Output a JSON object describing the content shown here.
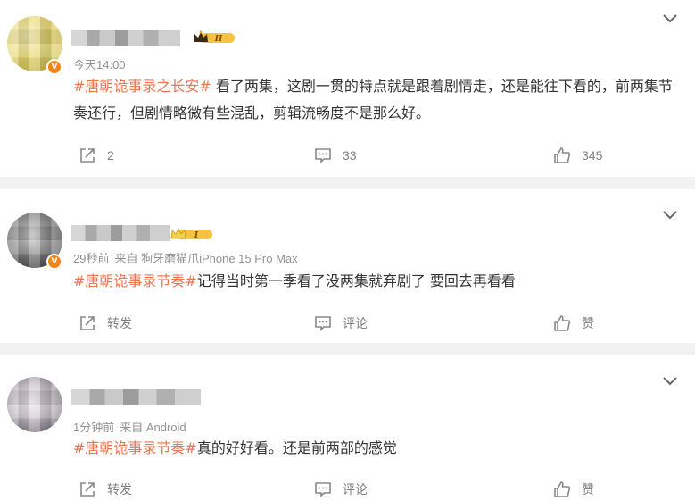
{
  "posts": [
    {
      "time": "今天14:00",
      "source": "",
      "topic": "#唐朝诡事录之长安#",
      "text": "看了两集，这剧一贯的特点就是跟着剧情走，还是能往下看的，前两集节奏还行，但剧情略微有些混乱，剪辑流畅度不是那么好。",
      "level": "II",
      "verified_badge": "V",
      "share_label": "2",
      "comment_label": "33",
      "like_label": "345"
    },
    {
      "time": "29秒前",
      "source": "来自 狗牙磨猫爪iPhone 15 Pro Max",
      "topic": "#唐朝诡事录节奏#",
      "text": "记得当时第一季看了没两集就弃剧了 要回去再看看",
      "level": "I",
      "verified_badge": "V",
      "share_label": "转发",
      "comment_label": "评论",
      "like_label": "赞"
    },
    {
      "time": "1分钟前",
      "source": "来自 Android",
      "topic": "#唐朝诡事录节奏#",
      "text": "真的好好看。还是前两部的感觉",
      "share_label": "转发",
      "comment_label": "评论",
      "like_label": "赞"
    }
  ],
  "icons": {
    "share": "share-icon",
    "comment": "comment-icon",
    "like": "like-icon",
    "more": "chevron-down-icon"
  },
  "colors": {
    "topic": "#eb7350",
    "meta": "#939393",
    "badge": "#f78314",
    "crown_gold": "#e8a317"
  }
}
